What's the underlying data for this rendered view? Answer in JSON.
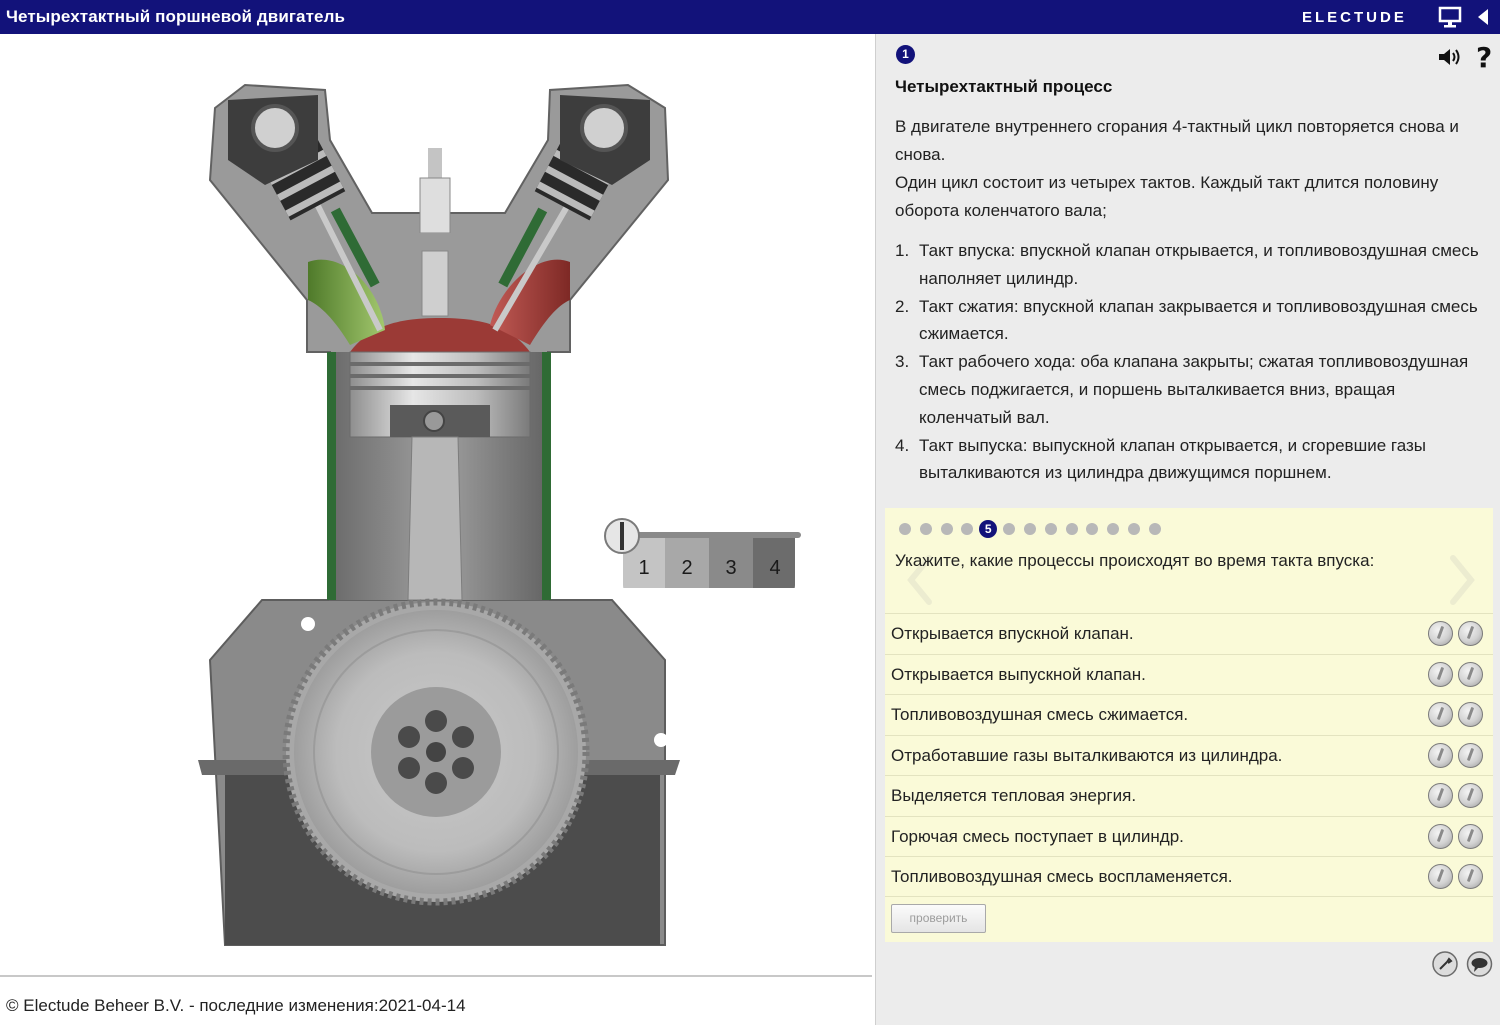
{
  "window": {
    "title": "Четырехтактный поршневой двигатель",
    "brand": "ELECTUDE"
  },
  "icons": {
    "monitor": "monitor-icon",
    "collapse": "triangle-left-icon",
    "sound": "speaker-icon",
    "help": "question-icon",
    "prev": "chevron-left-icon",
    "next": "chevron-right-icon",
    "tool_a": "wrench-icon",
    "tool_b": "speech-bubble-icon"
  },
  "colors": {
    "titlebar": "#12127a",
    "panel": "#ececec",
    "quiz_bg": "#fafad8",
    "intake_gas": "#6f9a3c",
    "exhaust_gas": "#a33a36",
    "combustion": "#9b3a36"
  },
  "engine": {
    "stroke_selector": [
      "1",
      "2",
      "3",
      "4"
    ],
    "selected_stroke_level": 0
  },
  "panel": {
    "step_number": "1",
    "help_symbol": "?",
    "heading": "Четырехтактный процесс",
    "intro_1": "В двигателе внутреннего сгорания 4-тактный цикл повторяется снова и снова.",
    "intro_2": "Один цикл состоит из четырех тактов. Каждый такт длится половину оборота коленчатого вала;",
    "steps": [
      {
        "n": "1.",
        "text": "Такт впуска: впускной клапан открывается, и топливовоздушная смесь наполняет цилиндр."
      },
      {
        "n": "2.",
        "text": "Такт сжатия: впускной клапан закрывается и топливовоздушная смесь сжимается."
      },
      {
        "n": "3.",
        "text": "Такт рабочего хода: оба клапана закрыты; сжатая топливовоздушная смесь поджигается, и поршень выталкивается вниз, вращая коленчатый вал."
      },
      {
        "n": "4.",
        "text": "Такт выпуска: выпускной клапан открывается, и сгоревшие газы выталкиваются из цилиндра движущимся поршнем."
      }
    ]
  },
  "quiz": {
    "active_page": "5",
    "question": "Укажите, какие процессы происходят во время такта впуска:",
    "answers": [
      "Открывается впускной клапан.",
      "Открывается выпускной клапан.",
      "Топливовоздушная смесь сжимается.",
      "Отработавшие газы выталкиваются из цилиндра.",
      "Выделяется тепловая энергия.",
      "Горючая смесь поступает в цилиндр.",
      "Топливовоздушная смесь воспламеняется."
    ],
    "check_label": "проверить"
  },
  "footer": {
    "text": "© Electude Beheer B.V. - последние изменения:2021-04-14"
  }
}
